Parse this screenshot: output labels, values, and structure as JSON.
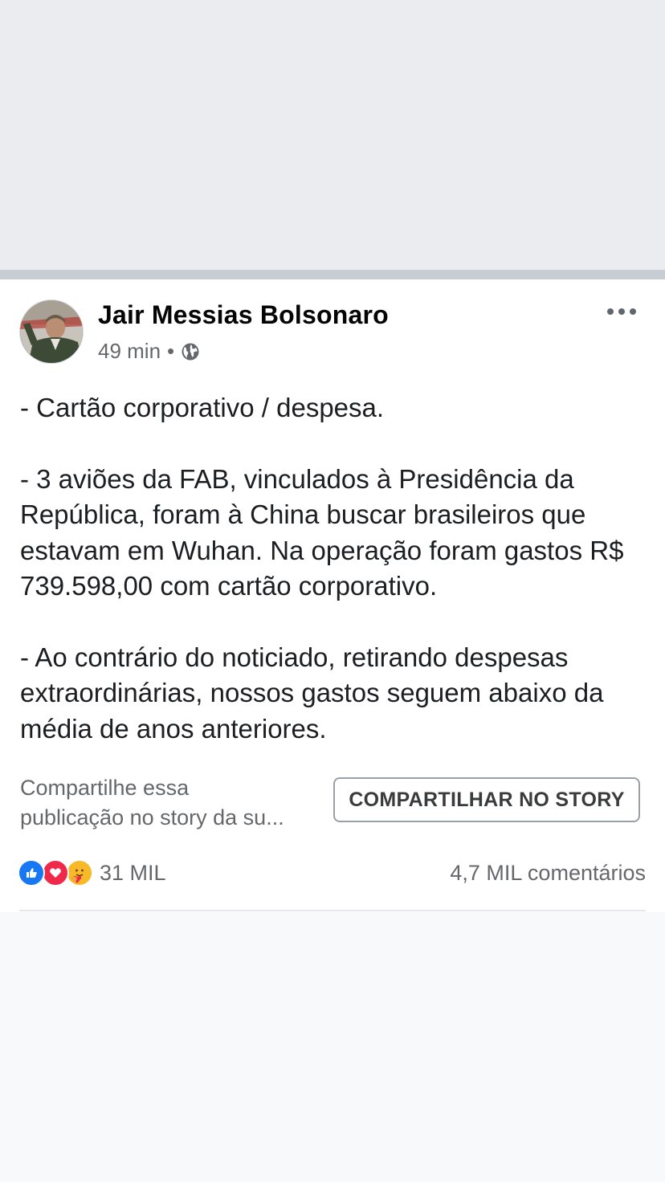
{
  "post": {
    "author": "Jair Messias Bolsonaro",
    "time": "49 min",
    "separator": "•",
    "audience_icon": "globe-icon",
    "more_icon": "more-options-icon",
    "paragraphs": [
      "- Cartão corporativo / despesa.",
      "- 3 aviões da FAB, vinculados à Presidência da República, foram à China buscar brasileiros que estavam em Wuhan. Na operação foram gastos R$ 739.598,00 com cartão corporativo.",
      "- Ao contrário do noticiado, retirando despesas extraordinárias,  nossos gastos seguem abaixo da média de anos anteriores."
    ]
  },
  "share": {
    "hint_line1": "Compartilhe essa",
    "hint_line2": "publicação no story da su...",
    "button_label": "COMPARTILHAR NO STORY"
  },
  "stats": {
    "reaction_icons": [
      "like-icon",
      "love-icon",
      "care-icon"
    ],
    "reactions_count": "31 MIL",
    "comments": "4,7 MIL comentários"
  },
  "colors": {
    "like": "#1877f2",
    "love": "#f0284a",
    "care": "#f7b928",
    "header_background": "#ebecf0"
  }
}
